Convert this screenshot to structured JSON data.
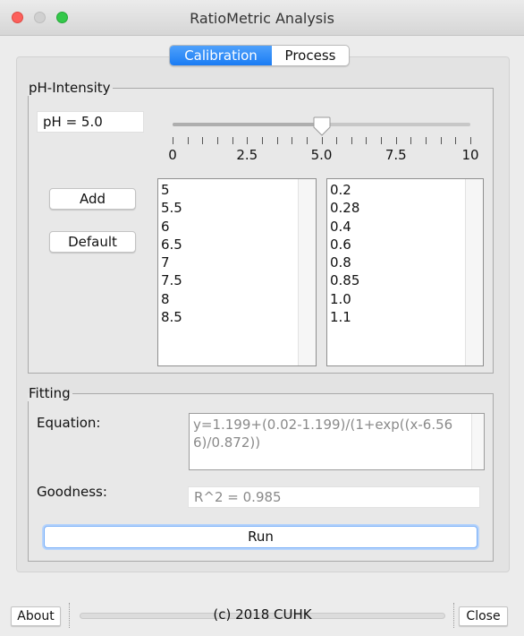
{
  "window": {
    "title": "RatioMetric Analysis"
  },
  "tabs": [
    {
      "label": "Calibration",
      "active": true
    },
    {
      "label": "Process",
      "active": false
    }
  ],
  "ph_group": {
    "title": "pH-Intensity",
    "ph_value_text": "pH = 5.0",
    "slider": {
      "min": 0,
      "max": 10,
      "value": 5.0,
      "major_labels": [
        "0",
        "2.5",
        "5.0",
        "7.5",
        "10"
      ]
    },
    "add_label": "Add",
    "default_label": "Default",
    "ph_list": [
      "5",
      "5.5",
      "6",
      "6.5",
      "7",
      "7.5",
      "8",
      "8.5"
    ],
    "intensity_list": [
      "0.2",
      "0.28",
      "0.4",
      "0.6",
      "0.8",
      "0.85",
      "1.0",
      "1.1"
    ]
  },
  "fitting": {
    "title": "Fitting",
    "equation_label": "Equation:",
    "equation_value": "y=1.199+(0.02-1.199)/(1+exp((x-6.566)/0.872))",
    "goodness_label": "Goodness:",
    "goodness_value": "R^2 = 0.985",
    "run_label": "Run"
  },
  "footer": {
    "about_label": "About",
    "copyright": "(c) 2018 CUHK",
    "close_label": "Close"
  },
  "colors": {
    "accent": "#1a7cf4",
    "close_light": "#fc605c",
    "max_light": "#34c84a"
  }
}
